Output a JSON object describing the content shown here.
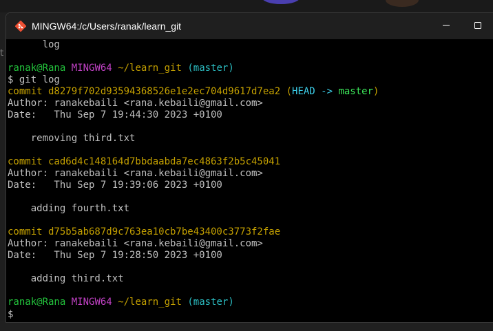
{
  "window": {
    "title": "MINGW64:/c/Users/ranak/learn_git"
  },
  "background": {
    "side_hint": "t"
  },
  "terminal": {
    "lines": [
      [
        {
          "t": "      log",
          "c": "white"
        }
      ],
      [],
      [
        {
          "t": "ranak@Rana",
          "c": "green"
        },
        {
          "t": " ",
          "c": "white"
        },
        {
          "t": "MINGW64",
          "c": "magenta"
        },
        {
          "t": " ",
          "c": "white"
        },
        {
          "t": "~/learn_git",
          "c": "yellow"
        },
        {
          "t": " ",
          "c": "white"
        },
        {
          "t": "(master)",
          "c": "cyan"
        }
      ],
      [
        {
          "t": "$ git log",
          "c": "white"
        }
      ],
      [
        {
          "t": "commit d8279f702d93594368526e1e2ec704d9617d7ea2 ",
          "c": "yellow"
        },
        {
          "t": "(",
          "c": "yellow"
        },
        {
          "t": "HEAD -> ",
          "c": "head"
        },
        {
          "t": "master",
          "c": "brightgreen"
        },
        {
          "t": ")",
          "c": "yellow"
        }
      ],
      [
        {
          "t": "Author: ranakebaili <rana.kebaili@gmail.com>",
          "c": "white"
        }
      ],
      [
        {
          "t": "Date:   Thu Sep 7 19:44:30 2023 +0100",
          "c": "white"
        }
      ],
      [],
      [
        {
          "t": "    removing third.txt",
          "c": "white"
        }
      ],
      [],
      [
        {
          "t": "commit cad6d4c148164d7bbdaabda7ec4863f2b5c45041",
          "c": "yellow"
        }
      ],
      [
        {
          "t": "Author: ranakebaili <rana.kebaili@gmail.com>",
          "c": "white"
        }
      ],
      [
        {
          "t": "Date:   Thu Sep 7 19:39:06 2023 +0100",
          "c": "white"
        }
      ],
      [],
      [
        {
          "t": "    adding fourth.txt",
          "c": "white"
        }
      ],
      [],
      [
        {
          "t": "commit d75b5ab687d9c763ea10cb7be43400c3773f2fae",
          "c": "yellow"
        }
      ],
      [
        {
          "t": "Author: ranakebaili <rana.kebaili@gmail.com>",
          "c": "white"
        }
      ],
      [
        {
          "t": "Date:   Thu Sep 7 19:28:50 2023 +0100",
          "c": "white"
        }
      ],
      [],
      [
        {
          "t": "    adding third.txt",
          "c": "white"
        }
      ],
      [],
      [
        {
          "t": "ranak@Rana",
          "c": "green"
        },
        {
          "t": " ",
          "c": "white"
        },
        {
          "t": "MINGW64",
          "c": "magenta"
        },
        {
          "t": " ",
          "c": "white"
        },
        {
          "t": "~/learn_git",
          "c": "yellow"
        },
        {
          "t": " ",
          "c": "white"
        },
        {
          "t": "(master)",
          "c": "cyan"
        }
      ],
      [
        {
          "t": "$",
          "c": "white"
        }
      ]
    ]
  },
  "icons": {
    "app": "git-bash-icon",
    "minimize": "minimize-icon",
    "maximize": "maximize-icon"
  },
  "colors": {
    "green": "#23c43c",
    "magenta": "#c041c4",
    "yellow": "#c4a000",
    "cyan": "#2cbfc4",
    "head": "#3ccde8",
    "brightgreen": "#3ce85a",
    "white": "#c0c0c0",
    "terminal_bg": "#000000",
    "titlebar_bg": "#1f1f1f"
  }
}
